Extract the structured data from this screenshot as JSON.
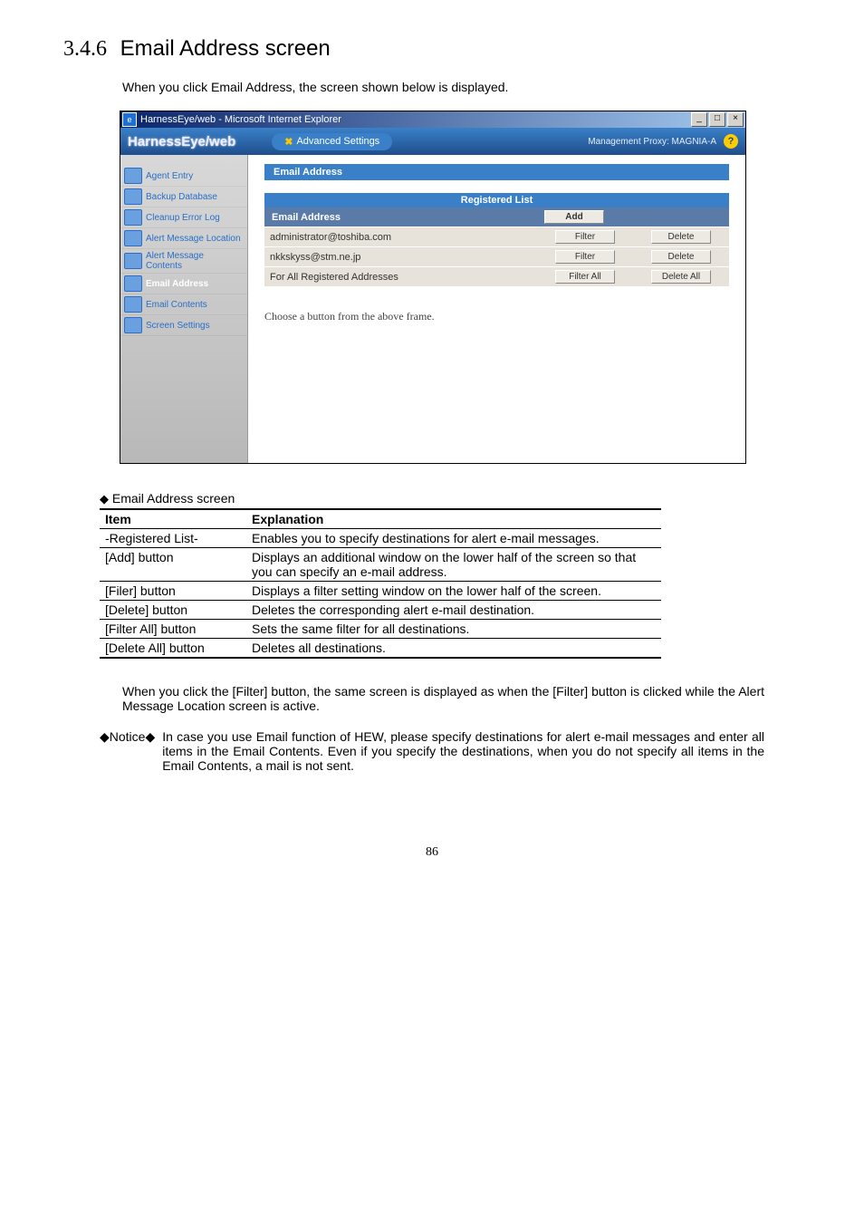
{
  "section": {
    "number": "3.4.6",
    "title": "Email Address screen"
  },
  "intro": "When you click Email Address, the screen shown below is displayed.",
  "ie": {
    "title": "HarnessEye/web - Microsoft Internet Explorer",
    "min": "_",
    "max": "□",
    "close": "×"
  },
  "app": {
    "logo": "HarnessEye/web",
    "tabLabel": "Advanced Settings",
    "mgmtProxy": "Management Proxy: MAGNIA-A",
    "help": "?"
  },
  "sidebar": {
    "items": [
      {
        "label": "Agent Entry"
      },
      {
        "label": "Backup Database"
      },
      {
        "label": "Cleanup Error Log"
      },
      {
        "label": "Alert Message Location"
      },
      {
        "label": "Alert Message Contents"
      },
      {
        "label": "Email Address",
        "active": true
      },
      {
        "label": "Email Contents"
      },
      {
        "label": "Screen Settings"
      }
    ]
  },
  "panel": {
    "title": "Email Address",
    "registeredHeader": "Registered List",
    "colEmail": "Email Address",
    "addBtn": "Add",
    "filterBtn": "Filter",
    "deleteBtn": "Delete",
    "filterAllBtn": "Filter All",
    "deleteAllBtn": "Delete All",
    "rows": [
      {
        "email": "administrator@toshiba.com"
      },
      {
        "email": "nkkskyss@stm.ne.jp"
      }
    ],
    "allRow": "For All Registered Addresses",
    "lowerMsg": "Choose a button from the above frame."
  },
  "explTitle": "Email Address screen",
  "explHeader": {
    "item": "Item",
    "explanation": "Explanation"
  },
  "explRows": [
    {
      "item": "-Registered List-",
      "text": "Enables you to specify destinations for alert e-mail messages."
    },
    {
      "item": "[Add] button",
      "text": "Displays an additional window on the lower half of the screen so that you can specify an e-mail address."
    },
    {
      "item": "[Filer] button",
      "text": "Displays a filter setting window on the lower half of the screen."
    },
    {
      "item": "[Delete] button",
      "text": "Deletes the corresponding alert e-mail destination."
    },
    {
      "item": "[Filter All] button",
      "text": "Sets the same filter for all destinations."
    },
    {
      "item": "[Delete All] button",
      "text": "Deletes all destinations."
    }
  ],
  "para": "When you click the [Filter] button, the same screen is displayed as when the [Filter] button is clicked while the Alert Message Location screen is active.",
  "notice": {
    "label": "◆Notice◆",
    "text": "In case you use Email function of HEW, please specify destinations for alert e-mail messages and enter all items in the Email Contents. Even if you specify the destinations, when you do not specify all items in the Email Contents, a mail is not sent."
  },
  "pageNumber": "86"
}
